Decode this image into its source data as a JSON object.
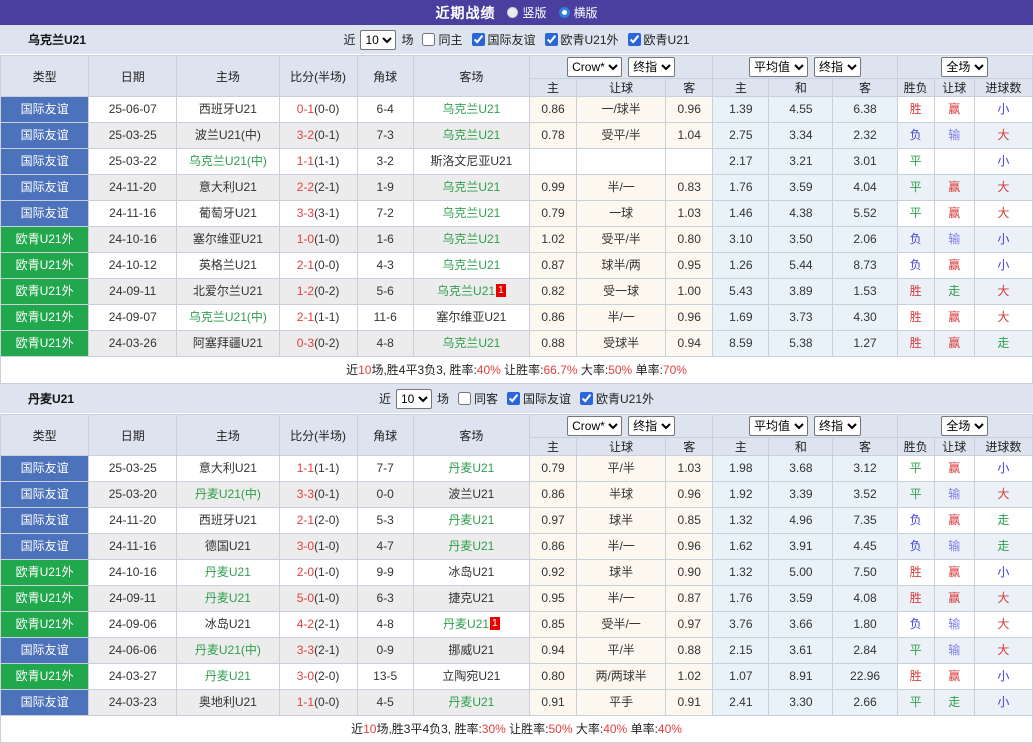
{
  "title_bar": {
    "title": "近期战绩",
    "vertical_label": "竖版",
    "horizontal_label": "横版"
  },
  "colors": {
    "title_purple": "#4a3f9f",
    "type_blue": "#4d72bc",
    "type_green": "#21a84d",
    "team_green": "#2f9e4e",
    "score_red": "#e53e3e",
    "win_red": "#d83a3a",
    "draw_green": "#2f9e4e",
    "loss_blue": "#4343d9",
    "lose_lightblue": "#7d7de8",
    "header_bg": "#dde4ef",
    "crow_bg": "#fcf7ef",
    "avg_bg": "#e9f2f9"
  },
  "table_headers": {
    "main": [
      "类型",
      "日期",
      "主场",
      "比分(半场)",
      "角球",
      "客场"
    ],
    "group1_selects": [
      "Crow*",
      "终指"
    ],
    "group2_selects": [
      "平均值",
      "终指"
    ],
    "group3_selects": [
      "全场"
    ],
    "sub": [
      "主",
      "让球",
      "客",
      "主",
      "和",
      "客",
      "胜负",
      "让球",
      "进球数"
    ]
  },
  "sections": [
    {
      "team": "乌克兰U21",
      "filter": {
        "near_label": "近",
        "count": "10",
        "unit_label": "场",
        "same_checkbox": {
          "label": "同主",
          "checked": false
        },
        "league_checkboxes": [
          {
            "label": "国际友谊",
            "checked": true
          },
          {
            "label": "欧青U21外",
            "checked": true
          },
          {
            "label": "欧青U21",
            "checked": true
          }
        ]
      },
      "rows": [
        {
          "type": "国际友谊",
          "tc": "blue",
          "date": "25-06-07",
          "home": "西班牙U21",
          "hg": false,
          "score": "0-1",
          "half": "(0-0)",
          "corner": "6-4",
          "away": "乌克兰U21",
          "ag": true,
          "badge": "",
          "o1": "0.86",
          "hcap": "一/球半",
          "o2": "0.96",
          "a1": "1.39",
          "a2": "4.55",
          "a3": "6.38",
          "r1": "胜",
          "c1": "r",
          "r2": "赢",
          "c2": "r",
          "r3": "小",
          "c3": "b"
        },
        {
          "type": "国际友谊",
          "tc": "blue",
          "date": "25-03-25",
          "home": "波兰U21(中)",
          "hg": false,
          "score": "3-2",
          "half": "(0-1)",
          "corner": "7-3",
          "away": "乌克兰U21",
          "ag": true,
          "badge": "",
          "o1": "0.78",
          "hcap": "受平/半",
          "o2": "1.04",
          "a1": "2.75",
          "a2": "3.34",
          "a3": "2.32",
          "r1": "负",
          "c1": "b",
          "r2": "输",
          "c2": "lb",
          "r3": "大",
          "c3": "r"
        },
        {
          "type": "国际友谊",
          "tc": "blue",
          "date": "25-03-22",
          "home": "乌克兰U21(中)",
          "hg": true,
          "score": "1-1",
          "half": "(1-1)",
          "corner": "3-2",
          "away": "斯洛文尼亚U21",
          "ag": false,
          "badge": "",
          "o1": "",
          "hcap": "",
          "o2": "",
          "a1": "2.17",
          "a2": "3.21",
          "a3": "3.01",
          "r1": "平",
          "c1": "g",
          "r2": "",
          "c2": "",
          "r3": "小",
          "c3": "b"
        },
        {
          "type": "国际友谊",
          "tc": "blue",
          "date": "24-11-20",
          "home": "意大利U21",
          "hg": false,
          "score": "2-2",
          "half": "(2-1)",
          "corner": "1-9",
          "away": "乌克兰U21",
          "ag": true,
          "badge": "",
          "o1": "0.99",
          "hcap": "半/一",
          "o2": "0.83",
          "a1": "1.76",
          "a2": "3.59",
          "a3": "4.04",
          "r1": "平",
          "c1": "g",
          "r2": "赢",
          "c2": "r",
          "r3": "大",
          "c3": "r"
        },
        {
          "type": "国际友谊",
          "tc": "blue",
          "date": "24-11-16",
          "home": "葡萄牙U21",
          "hg": false,
          "score": "3-3",
          "half": "(3-1)",
          "corner": "7-2",
          "away": "乌克兰U21",
          "ag": true,
          "badge": "",
          "o1": "0.79",
          "hcap": "一球",
          "o2": "1.03",
          "a1": "1.46",
          "a2": "4.38",
          "a3": "5.52",
          "r1": "平",
          "c1": "g",
          "r2": "赢",
          "c2": "r",
          "r3": "大",
          "c3": "r"
        },
        {
          "type": "欧青U21外",
          "tc": "green",
          "date": "24-10-16",
          "home": "塞尔维亚U21",
          "hg": false,
          "score": "1-0",
          "half": "(1-0)",
          "corner": "1-6",
          "away": "乌克兰U21",
          "ag": true,
          "badge": "",
          "o1": "1.02",
          "hcap": "受平/半",
          "o2": "0.80",
          "a1": "3.10",
          "a2": "3.50",
          "a3": "2.06",
          "r1": "负",
          "c1": "b",
          "r2": "输",
          "c2": "lb",
          "r3": "小",
          "c3": "b"
        },
        {
          "type": "欧青U21外",
          "tc": "green",
          "date": "24-10-12",
          "home": "英格兰U21",
          "hg": false,
          "score": "2-1",
          "half": "(0-0)",
          "corner": "4-3",
          "away": "乌克兰U21",
          "ag": true,
          "badge": "",
          "o1": "0.87",
          "hcap": "球半/两",
          "o2": "0.95",
          "a1": "1.26",
          "a2": "5.44",
          "a3": "8.73",
          "r1": "负",
          "c1": "b",
          "r2": "赢",
          "c2": "r",
          "r3": "小",
          "c3": "b"
        },
        {
          "type": "欧青U21外",
          "tc": "green",
          "date": "24-09-11",
          "home": "北爱尔兰U21",
          "hg": false,
          "score": "1-2",
          "half": "(0-2)",
          "corner": "5-6",
          "away": "乌克兰U21",
          "ag": true,
          "badge": "1",
          "o1": "0.82",
          "hcap": "受一球",
          "o2": "1.00",
          "a1": "5.43",
          "a2": "3.89",
          "a3": "1.53",
          "r1": "胜",
          "c1": "r",
          "r2": "走",
          "c2": "g",
          "r3": "大",
          "c3": "r"
        },
        {
          "type": "欧青U21外",
          "tc": "green",
          "date": "24-09-07",
          "home": "乌克兰U21(中)",
          "hg": true,
          "score": "2-1",
          "half": "(1-1)",
          "corner": "11-6",
          "away": "塞尔维亚U21",
          "ag": false,
          "badge": "",
          "o1": "0.86",
          "hcap": "半/一",
          "o2": "0.96",
          "a1": "1.69",
          "a2": "3.73",
          "a3": "4.30",
          "r1": "胜",
          "c1": "r",
          "r2": "赢",
          "c2": "r",
          "r3": "大",
          "c3": "r"
        },
        {
          "type": "欧青U21外",
          "tc": "green",
          "date": "24-03-26",
          "home": "阿塞拜疆U21",
          "hg": false,
          "score": "0-3",
          "half": "(0-2)",
          "corner": "4-8",
          "away": "乌克兰U21",
          "ag": true,
          "badge": "",
          "o1": "0.88",
          "hcap": "受球半",
          "o2": "0.94",
          "a1": "8.59",
          "a2": "5.38",
          "a3": "1.27",
          "r1": "胜",
          "c1": "r",
          "r2": "赢",
          "c2": "r",
          "r3": "走",
          "c3": "g"
        }
      ],
      "summary": [
        [
          "近",
          0
        ],
        [
          "10",
          1
        ],
        [
          "场,胜4平3负3, 胜率:",
          0
        ],
        [
          "40%",
          1
        ],
        [
          " 让胜率:",
          0
        ],
        [
          "66.7%",
          1
        ],
        [
          " 大率:",
          0
        ],
        [
          "50%",
          1
        ],
        [
          " 单率:",
          0
        ],
        [
          "70%",
          1
        ]
      ]
    },
    {
      "team": "丹麦U21",
      "filter": {
        "near_label": "近",
        "count": "10",
        "unit_label": "场",
        "same_checkbox": {
          "label": "同客",
          "checked": false
        },
        "league_checkboxes": [
          {
            "label": "国际友谊",
            "checked": true
          },
          {
            "label": "欧青U21外",
            "checked": true
          }
        ]
      },
      "rows": [
        {
          "type": "国际友谊",
          "tc": "blue",
          "date": "25-03-25",
          "home": "意大利U21",
          "hg": false,
          "score": "1-1",
          "half": "(1-1)",
          "corner": "7-7",
          "away": "丹麦U21",
          "ag": true,
          "badge": "",
          "o1": "0.79",
          "hcap": "平/半",
          "o2": "1.03",
          "a1": "1.98",
          "a2": "3.68",
          "a3": "3.12",
          "r1": "平",
          "c1": "g",
          "r2": "赢",
          "c2": "r",
          "r3": "小",
          "c3": "b"
        },
        {
          "type": "国际友谊",
          "tc": "blue",
          "date": "25-03-20",
          "home": "丹麦U21(中)",
          "hg": true,
          "score": "3-3",
          "half": "(0-1)",
          "corner": "0-0",
          "away": "波兰U21",
          "ag": false,
          "badge": "",
          "o1": "0.86",
          "hcap": "半球",
          "o2": "0.96",
          "a1": "1.92",
          "a2": "3.39",
          "a3": "3.52",
          "r1": "平",
          "c1": "g",
          "r2": "输",
          "c2": "lb",
          "r3": "大",
          "c3": "r"
        },
        {
          "type": "国际友谊",
          "tc": "blue",
          "date": "24-11-20",
          "home": "西班牙U21",
          "hg": false,
          "score": "2-1",
          "half": "(2-0)",
          "corner": "5-3",
          "away": "丹麦U21",
          "ag": true,
          "badge": "",
          "o1": "0.97",
          "hcap": "球半",
          "o2": "0.85",
          "a1": "1.32",
          "a2": "4.96",
          "a3": "7.35",
          "r1": "负",
          "c1": "b",
          "r2": "赢",
          "c2": "r",
          "r3": "走",
          "c3": "g"
        },
        {
          "type": "国际友谊",
          "tc": "blue",
          "date": "24-11-16",
          "home": "德国U21",
          "hg": false,
          "score": "3-0",
          "half": "(1-0)",
          "corner": "4-7",
          "away": "丹麦U21",
          "ag": true,
          "badge": "",
          "o1": "0.86",
          "hcap": "半/一",
          "o2": "0.96",
          "a1": "1.62",
          "a2": "3.91",
          "a3": "4.45",
          "r1": "负",
          "c1": "b",
          "r2": "输",
          "c2": "lb",
          "r3": "走",
          "c3": "g"
        },
        {
          "type": "欧青U21外",
          "tc": "green",
          "date": "24-10-16",
          "home": "丹麦U21",
          "hg": true,
          "score": "2-0",
          "half": "(1-0)",
          "corner": "9-9",
          "away": "冰岛U21",
          "ag": false,
          "badge": "",
          "o1": "0.92",
          "hcap": "球半",
          "o2": "0.90",
          "a1": "1.32",
          "a2": "5.00",
          "a3": "7.50",
          "r1": "胜",
          "c1": "r",
          "r2": "赢",
          "c2": "r",
          "r3": "小",
          "c3": "b"
        },
        {
          "type": "欧青U21外",
          "tc": "green",
          "date": "24-09-11",
          "home": "丹麦U21",
          "hg": true,
          "score": "5-0",
          "half": "(1-0)",
          "corner": "6-3",
          "away": "捷克U21",
          "ag": false,
          "badge": "",
          "o1": "0.95",
          "hcap": "半/一",
          "o2": "0.87",
          "a1": "1.76",
          "a2": "3.59",
          "a3": "4.08",
          "r1": "胜",
          "c1": "r",
          "r2": "赢",
          "c2": "r",
          "r3": "大",
          "c3": "r"
        },
        {
          "type": "欧青U21外",
          "tc": "green",
          "date": "24-09-06",
          "home": "冰岛U21",
          "hg": false,
          "score": "4-2",
          "half": "(2-1)",
          "corner": "4-8",
          "away": "丹麦U21",
          "ag": true,
          "badge": "1",
          "o1": "0.85",
          "hcap": "受半/一",
          "o2": "0.97",
          "a1": "3.76",
          "a2": "3.66",
          "a3": "1.80",
          "r1": "负",
          "c1": "b",
          "r2": "输",
          "c2": "lb",
          "r3": "大",
          "c3": "r"
        },
        {
          "type": "国际友谊",
          "tc": "blue",
          "date": "24-06-06",
          "home": "丹麦U21(中)",
          "hg": true,
          "score": "3-3",
          "half": "(2-1)",
          "corner": "0-9",
          "away": "挪威U21",
          "ag": false,
          "badge": "",
          "o1": "0.94",
          "hcap": "平/半",
          "o2": "0.88",
          "a1": "2.15",
          "a2": "3.61",
          "a3": "2.84",
          "r1": "平",
          "c1": "g",
          "r2": "输",
          "c2": "lb",
          "r3": "大",
          "c3": "r"
        },
        {
          "type": "欧青U21外",
          "tc": "green",
          "date": "24-03-27",
          "home": "丹麦U21",
          "hg": true,
          "score": "3-0",
          "half": "(2-0)",
          "corner": "13-5",
          "away": "立陶宛U21",
          "ag": false,
          "badge": "",
          "o1": "0.80",
          "hcap": "两/两球半",
          "o2": "1.02",
          "a1": "1.07",
          "a2": "8.91",
          "a3": "22.96",
          "r1": "胜",
          "c1": "r",
          "r2": "赢",
          "c2": "r",
          "r3": "小",
          "c3": "b"
        },
        {
          "type": "国际友谊",
          "tc": "blue",
          "date": "24-03-23",
          "home": "奥地利U21",
          "hg": false,
          "score": "1-1",
          "half": "(0-0)",
          "corner": "4-5",
          "away": "丹麦U21",
          "ag": true,
          "badge": "",
          "o1": "0.91",
          "hcap": "平手",
          "o2": "0.91",
          "a1": "2.41",
          "a2": "3.30",
          "a3": "2.66",
          "r1": "平",
          "c1": "g",
          "r2": "走",
          "c2": "g",
          "r3": "小",
          "c3": "b"
        }
      ],
      "summary": [
        [
          "近",
          0
        ],
        [
          "10",
          1
        ],
        [
          "场,胜3平4负3, 胜率:",
          0
        ],
        [
          "30%",
          1
        ],
        [
          " 让胜率:",
          0
        ],
        [
          "50%",
          1
        ],
        [
          " 大率:",
          0
        ],
        [
          "40%",
          1
        ],
        [
          " 单率:",
          0
        ],
        [
          "40%",
          1
        ]
      ]
    }
  ]
}
